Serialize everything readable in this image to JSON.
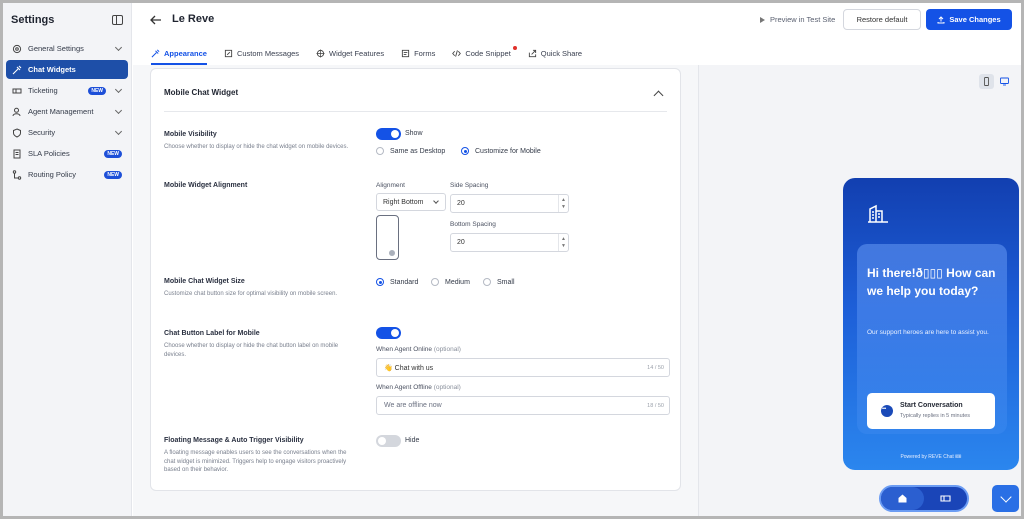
{
  "sidebar": {
    "title": "Settings",
    "items": [
      {
        "label": "General Settings",
        "icon": "gear-icon"
      },
      {
        "label": "Chat Widgets",
        "icon": "brush-icon"
      },
      {
        "label": "Ticketing",
        "icon": "ticket-icon",
        "badge": "NEW"
      },
      {
        "label": "Agent Management",
        "icon": "user-icon"
      },
      {
        "label": "Security",
        "icon": "shield-icon"
      },
      {
        "label": "SLA Policies",
        "icon": "document-icon",
        "badge": "NEW"
      },
      {
        "label": "Routing Policy",
        "icon": "routing-icon",
        "badge": "NEW"
      }
    ]
  },
  "header": {
    "title": "Le Reve",
    "preview_label": "Preview in Test Site",
    "restore_label": "Restore default",
    "save_label": "Save Changes"
  },
  "tabs": [
    {
      "label": "Appearance",
      "active": true
    },
    {
      "label": "Custom Messages"
    },
    {
      "label": "Widget Features"
    },
    {
      "label": "Forms"
    },
    {
      "label": "Code Snippet"
    },
    {
      "label": "Quick Share"
    }
  ],
  "card": {
    "title": "Mobile Chat Widget",
    "visibility": {
      "label": "Mobile Visibility",
      "desc": "Choose whether to display or hide the chat widget on mobile devices.",
      "toggle_label": "Show",
      "option_desktop": "Same as Desktop",
      "option_mobile": "Customize for Mobile"
    },
    "alignment": {
      "label": "Mobile Widget Alignment",
      "alignment_label": "Alignment",
      "alignment_value": "Right Bottom",
      "side_label": "Side Spacing",
      "side_value": "20",
      "bottom_label": "Bottom Spacing",
      "bottom_value": "20"
    },
    "size": {
      "label": "Mobile Chat Widget Size",
      "desc": "Customize chat button size for optimal visibility on mobile screen.",
      "opt_standard": "Standard",
      "opt_medium": "Medium",
      "opt_small": "Small"
    },
    "button_label": {
      "label": "Chat Button Label for Mobile",
      "desc": "Choose whether to display or hide the chat button label on mobile devices.",
      "online_label": "When Agent Online",
      "online_optional": "(optional)",
      "online_value": "👋 Chat with us",
      "online_count": "14 / 50",
      "offline_label": "When Agent Offline",
      "offline_optional": "(optional)",
      "offline_value": "We are offline now",
      "offline_count": "18 / 50"
    },
    "floating": {
      "label": "Floating Message & Auto Trigger Visibility",
      "desc": "A floating message enables users to see the conversations when the chat widget is minimized. Triggers help to engage visitors proactively based on their behavior.",
      "toggle_label": "Hide"
    }
  },
  "widget": {
    "greeting": "Hi there!ð▯▯▯ How can we help you today?",
    "subtext": "Our support heroes are here to assist you.",
    "cta_title": "Start Conversation",
    "cta_sub": "Typically replies in 5 minutes",
    "powered": "Powered by REVE Chat 🎟"
  },
  "colors": {
    "accent": "#1452e6",
    "sidebar_active": "#1e4fa8"
  }
}
